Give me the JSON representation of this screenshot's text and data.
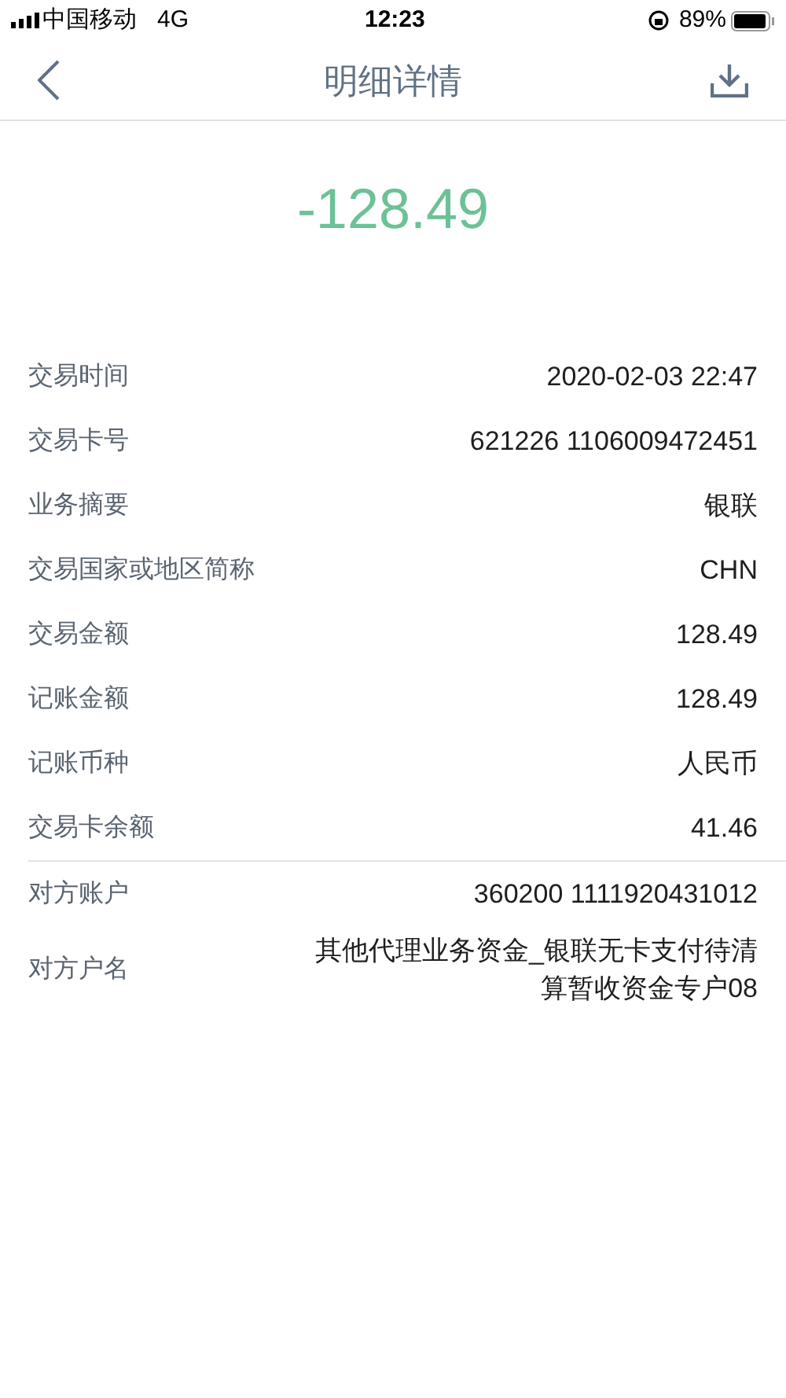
{
  "status_bar": {
    "carrier": "中国移动",
    "network": "4G",
    "time": "12:23",
    "battery_percent": "89%"
  },
  "header": {
    "title": "明细详情"
  },
  "amount": "-128.49",
  "sections": [
    {
      "rows": [
        {
          "label": "交易时间",
          "value": "2020-02-03 22:47"
        },
        {
          "label": "交易卡号",
          "value": "621226 1106009472451"
        },
        {
          "label": "业务摘要",
          "value": "银联"
        },
        {
          "label": "交易国家或地区简称",
          "value": "CHN"
        },
        {
          "label": "交易金额",
          "value": "128.49"
        },
        {
          "label": "记账金额",
          "value": "128.49"
        },
        {
          "label": "记账币种",
          "value": "人民币"
        },
        {
          "label": "交易卡余额",
          "value": "41.46"
        }
      ]
    },
    {
      "rows": [
        {
          "label": "对方账户",
          "value": "360200 1111920431012"
        },
        {
          "label": "对方户名",
          "value": "其他代理业务资金_银联无卡支付待清算暂收资金专户08"
        }
      ]
    }
  ]
}
